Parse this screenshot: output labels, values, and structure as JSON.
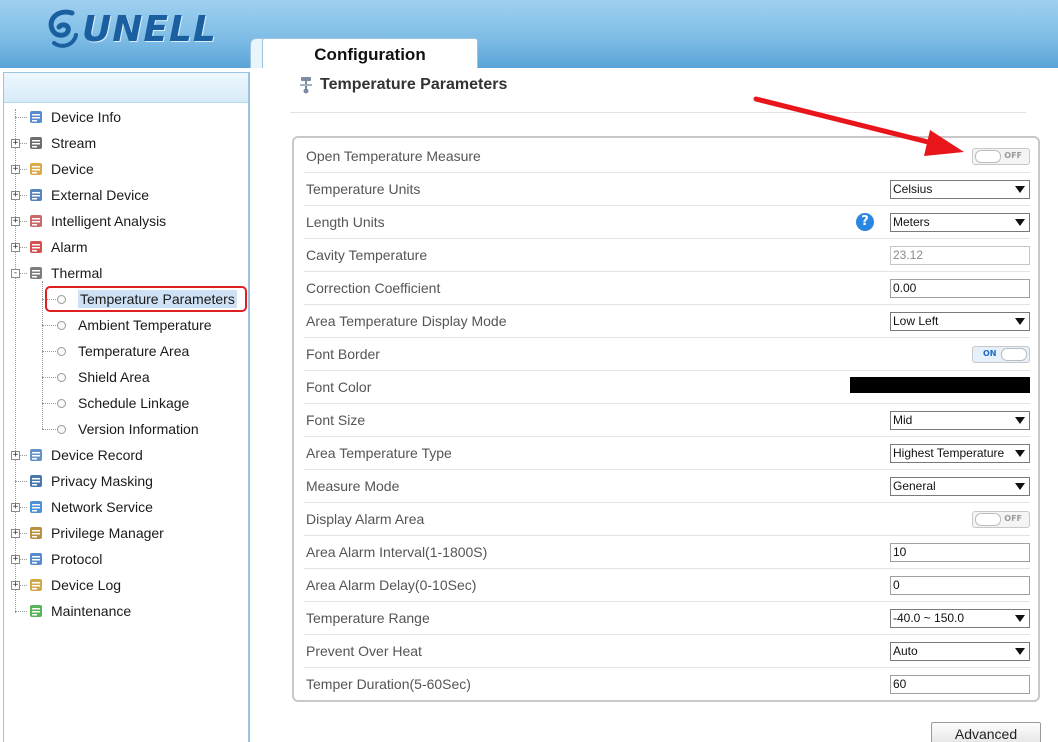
{
  "header": {
    "logo_text": "UNELL",
    "active_tab": "Configuration"
  },
  "sidebar": {
    "items": [
      {
        "label": "Device Info",
        "icon": "document-icon",
        "expandable": false
      },
      {
        "label": "Stream",
        "icon": "film-icon",
        "expandable": true
      },
      {
        "label": "Device",
        "icon": "device-icon",
        "expandable": true
      },
      {
        "label": "External Device",
        "icon": "plug-icon",
        "expandable": true
      },
      {
        "label": "Intelligent Analysis",
        "icon": "person-icon",
        "expandable": true
      },
      {
        "label": "Alarm",
        "icon": "alarm-icon",
        "expandable": true
      },
      {
        "label": "Thermal",
        "icon": "camera-icon",
        "expandable": true,
        "expanded": true
      },
      {
        "label": "Device Record",
        "icon": "record-icon",
        "expandable": true
      },
      {
        "label": "Privacy Masking",
        "icon": "monitor-icon",
        "expandable": false
      },
      {
        "label": "Network Service",
        "icon": "network-icon",
        "expandable": true
      },
      {
        "label": "Privilege Manager",
        "icon": "users-icon",
        "expandable": true
      },
      {
        "label": "Protocol",
        "icon": "protocol-icon",
        "expandable": true
      },
      {
        "label": "Device Log",
        "icon": "log-icon",
        "expandable": true
      },
      {
        "label": "Maintenance",
        "icon": "maintenance-icon",
        "expandable": false
      }
    ],
    "thermal_children": [
      {
        "label": "Temperature Parameters",
        "selected": true
      },
      {
        "label": "Ambient Temperature"
      },
      {
        "label": "Temperature Area"
      },
      {
        "label": "Shield Area"
      },
      {
        "label": "Schedule Linkage"
      },
      {
        "label": "Version Information"
      }
    ]
  },
  "main": {
    "title": "Temperature Parameters",
    "rows": [
      {
        "label": "Open Temperature Measure",
        "type": "toggle",
        "state": "OFF"
      },
      {
        "label": "Temperature Units",
        "type": "select",
        "value": "Celsius"
      },
      {
        "label": "Length Units",
        "type": "select",
        "value": "Meters",
        "help": "?"
      },
      {
        "label": "Cavity Temperature",
        "type": "input-disabled",
        "value": "23.12"
      },
      {
        "label": "Correction Coefficient",
        "type": "input",
        "value": "0.00"
      },
      {
        "label": "Area Temperature Display Mode",
        "type": "select",
        "value": "Low Left"
      },
      {
        "label": "Font Border",
        "type": "toggle",
        "state": "ON"
      },
      {
        "label": "Font Color",
        "type": "color",
        "value": "#000000"
      },
      {
        "label": "Font Size",
        "type": "select",
        "value": "Mid"
      },
      {
        "label": "Area Temperature Type",
        "type": "select",
        "value": "Highest Temperature"
      },
      {
        "label": "Measure Mode",
        "type": "select",
        "value": "General"
      },
      {
        "label": "Display Alarm Area",
        "type": "toggle",
        "state": "OFF"
      },
      {
        "label": "Area Alarm Interval(1-1800S)",
        "type": "input",
        "value": "10"
      },
      {
        "label": "Area Alarm Delay(0-10Sec)",
        "type": "input",
        "value": "0"
      },
      {
        "label": "Temperature Range",
        "type": "select",
        "value": "-40.0 ~ 150.0"
      },
      {
        "label": "Prevent Over Heat",
        "type": "select",
        "value": "Auto"
      },
      {
        "label": "Temper Duration(5-60Sec)",
        "type": "input",
        "value": "60"
      }
    ],
    "advanced_label": "Advanced"
  },
  "colors": {
    "header_blue": "#7fbde6",
    "selection_outline": "#e02020",
    "annotation_arrow": "#e8161b",
    "help_blue": "#2a86e0"
  }
}
